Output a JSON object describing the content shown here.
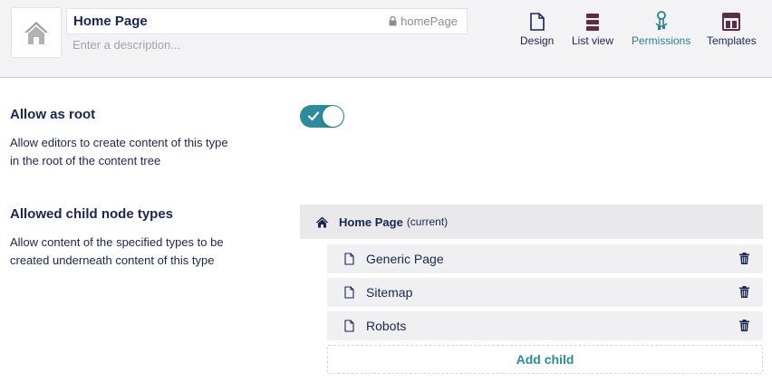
{
  "header": {
    "name": "Home Page",
    "alias": "homePage",
    "description_placeholder": "Enter a description...",
    "icon": "home-icon"
  },
  "apps": [
    {
      "label": "Design",
      "icon": "document-icon",
      "active": false
    },
    {
      "label": "List view",
      "icon": "list-icon",
      "active": false
    },
    {
      "label": "Permissions",
      "icon": "keys-icon",
      "active": true
    },
    {
      "label": "Templates",
      "icon": "layout-icon",
      "active": false
    }
  ],
  "allow_root": {
    "title": "Allow as root",
    "description": "Allow editors to create content of this type in the root of the content tree",
    "enabled": true
  },
  "allowed_children": {
    "title": "Allowed child node types",
    "description": "Allow content of the specified types to be created underneath content of this type",
    "root_name": "Home Page",
    "root_suffix": "(current)",
    "items": [
      "Generic Page",
      "Sitemap",
      "Robots"
    ],
    "add_label": "Add child"
  },
  "colors": {
    "accent": "#2a8c9c",
    "text": "#1b264f",
    "header_bg": "#f3f3f5"
  }
}
